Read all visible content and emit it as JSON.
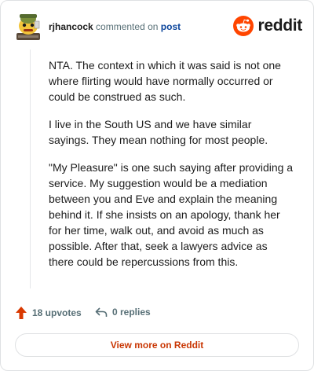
{
  "header": {
    "username": "rjhancock",
    "verb": "commented on",
    "post_link": "post",
    "brand": "reddit",
    "brand_color": "#ff4500"
  },
  "comment": {
    "paragraphs": [
      "NTA. The context in which it was said is not one where flirting would have normally occurred or could be construed as such.",
      "I live in the South US and we have similar sayings. They mean nothing for most people.",
      "\"My Pleasure\" is one such saying after providing a service. My suggestion would be a mediation between you and Eve and explain the meaning behind it. If she insists on an apology, thank her for her time, walk out, and avoid as much as possible. After that, seek a lawyers advice as there could be repercussions from this."
    ]
  },
  "actions": {
    "upvotes_label": "18 upvotes",
    "upvote_icon": "upvote-arrow-icon",
    "upvote_color": "#d93900",
    "replies_label": "0 replies",
    "reply_icon": "reply-arrow-icon"
  },
  "footer": {
    "view_more_label": "View more on Reddit",
    "view_more_color": "#c93704"
  }
}
